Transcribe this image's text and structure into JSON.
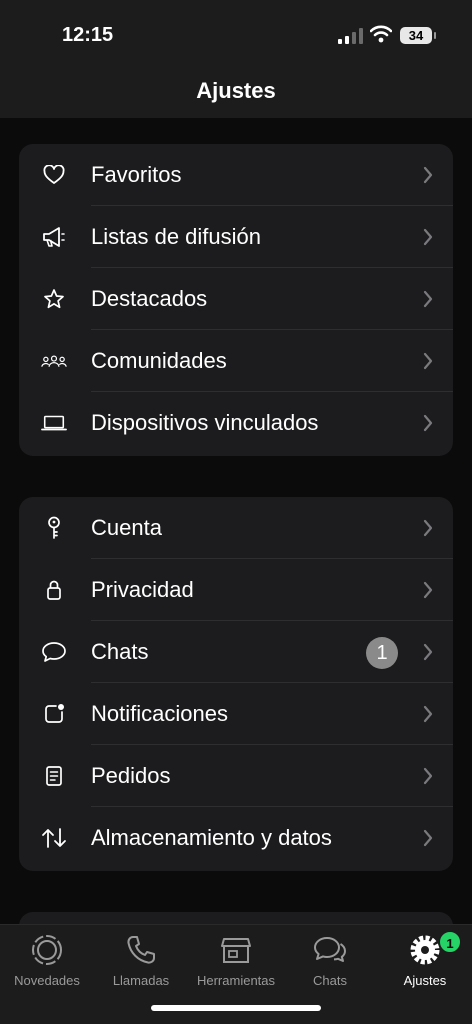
{
  "status_bar": {
    "time": "12:15",
    "battery_level": "34"
  },
  "header": {
    "title": "Ajustes"
  },
  "groups": [
    {
      "items": [
        {
          "label": "Favoritos",
          "icon": "heart-icon"
        },
        {
          "label": "Listas de difusión",
          "icon": "megaphone-icon"
        },
        {
          "label": "Destacados",
          "icon": "star-icon"
        },
        {
          "label": "Comunidades",
          "icon": "communities-icon"
        },
        {
          "label": "Dispositivos vinculados",
          "icon": "laptop-icon"
        }
      ]
    },
    {
      "items": [
        {
          "label": "Cuenta",
          "icon": "key-icon"
        },
        {
          "label": "Privacidad",
          "icon": "lock-icon"
        },
        {
          "label": "Chats",
          "icon": "chat-bubble-icon",
          "badge": "1"
        },
        {
          "label": "Notificaciones",
          "icon": "notification-icon"
        },
        {
          "label": "Pedidos",
          "icon": "receipt-icon"
        },
        {
          "label": "Almacenamiento y datos",
          "icon": "transfer-arrows-icon"
        }
      ]
    }
  ],
  "tab_bar": {
    "tabs": [
      {
        "label": "Novedades",
        "icon": "updates-icon"
      },
      {
        "label": "Llamadas",
        "icon": "phone-icon"
      },
      {
        "label": "Herramientas",
        "icon": "storefront-icon"
      },
      {
        "label": "Chats",
        "icon": "chats-icon"
      },
      {
        "label": "Ajustes",
        "icon": "settings-gear-icon",
        "active": true,
        "badge": "1"
      }
    ]
  },
  "colors": {
    "background": "#0b0b0b",
    "card": "#1c1c1e",
    "badge_green": "#25d366",
    "badge_gray": "#8a8a8a"
  }
}
